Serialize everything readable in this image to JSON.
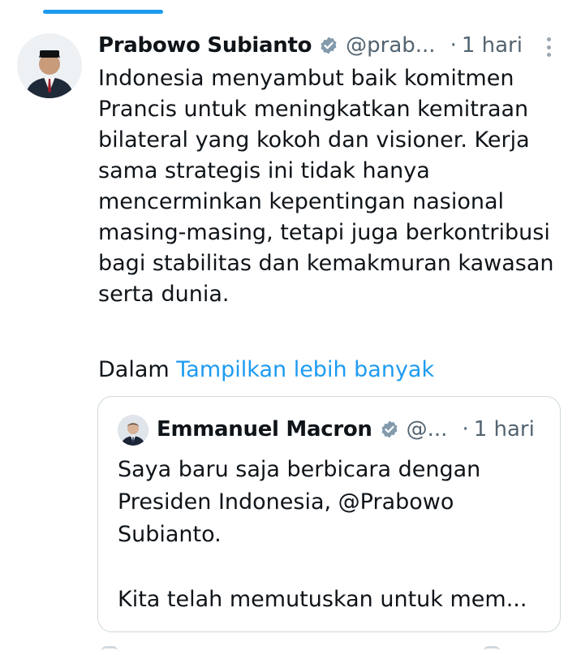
{
  "timeline": {
    "active_tab_color": "#1d9bf0"
  },
  "tweet": {
    "author_name": "Prabowo Subianto",
    "handle": "@prab...",
    "separator": "·",
    "time": "1 hari",
    "verified_icon": "verified-badge-icon",
    "more_icon": "more-vertical-icon",
    "avatar_icon": "person-suit-avatar",
    "text_lines": [
      "Indonesia menyambut baik komitmen",
      "Prancis untuk meningkatkan kemitraan",
      "bilateral yang kokoh dan visioner. Kerja",
      "sama strategis ini tidak hanya",
      "mencerminkan kepentingan nasional",
      "masing-masing, tetapi juga berkontribusi",
      "bagi stabilitas dan kemakmuran kawasan",
      "serta dunia."
    ],
    "show_more_prefix": "Dalam",
    "show_more_link": "Tampilkan lebih banyak"
  },
  "quote": {
    "author_name": "Emmanuel Macron",
    "handle": "@...",
    "separator": "·",
    "time": "1 hari",
    "verified_icon": "verified-badge-icon",
    "avatar_icon": "person-suit-avatar",
    "text_lines": [
      "Saya baru saja berbicara dengan",
      "Presiden Indonesia, @Prabowo",
      "Subianto.",
      "",
      "Kita telah memutuskan untuk mem..."
    ]
  },
  "colors": {
    "link": "#1d9bf0",
    "secondary_text": "#536471",
    "verified_badge": "#829aab",
    "border": "#cfd9de"
  }
}
